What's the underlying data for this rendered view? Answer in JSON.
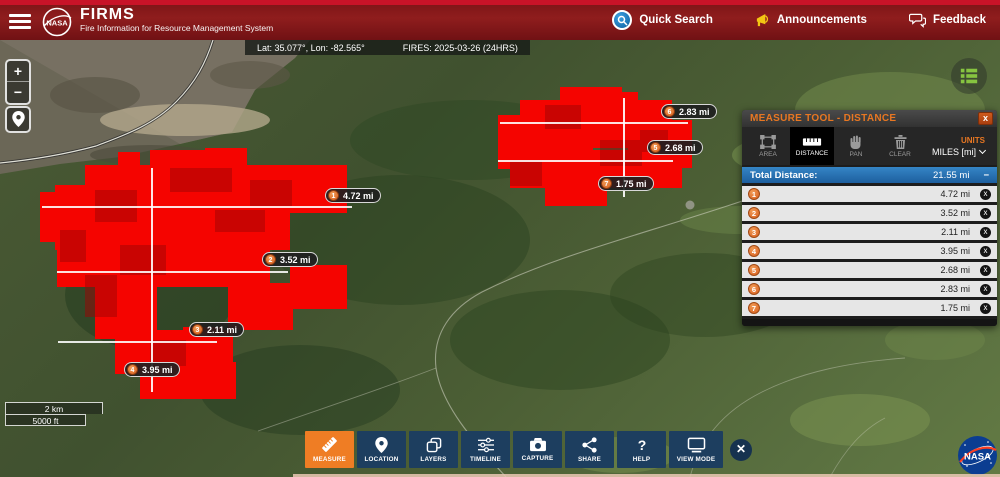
{
  "header": {
    "title": "FIRMS",
    "subtitle": "Fire Information for Resource Management System",
    "nav": {
      "quick_search": "Quick Search",
      "announcements": "Announcements",
      "feedback": "Feedback"
    }
  },
  "map": {
    "info_bar": {
      "coords": "Lat: 35.077°, Lon: -82.565°",
      "fires": "FIRES: 2025-03-26 (24HRS)"
    },
    "controls": {
      "zoom_in": "+",
      "zoom_out": "−"
    },
    "scale": {
      "km": "2 km",
      "ft": "5000 ft"
    },
    "labels": [
      {
        "num": "1",
        "text": "4.72 mi"
      },
      {
        "num": "2",
        "text": "3.52 mi"
      },
      {
        "num": "3",
        "text": "2.11 mi"
      },
      {
        "num": "4",
        "text": "3.95 mi"
      },
      {
        "num": "5",
        "text": "2.68 mi"
      },
      {
        "num": "6",
        "text": "2.83 mi"
      },
      {
        "num": "7",
        "text": "1.75 mi"
      }
    ]
  },
  "measure_panel": {
    "title": "MEASURE TOOL - DISTANCE",
    "close": "x",
    "tools": [
      {
        "label": "AREA"
      },
      {
        "label": "DISTANCE"
      },
      {
        "label": "PAN"
      },
      {
        "label": "CLEAR"
      }
    ],
    "units_label": "UNITS",
    "units_value": "MILES [mi]",
    "total_label": "Total Distance:",
    "total_value": "21.55 mi",
    "collapse": "−",
    "rows": [
      {
        "num": "1",
        "value": "4.72 mi",
        "delete": "x"
      },
      {
        "num": "2",
        "value": "3.52 mi",
        "delete": "x"
      },
      {
        "num": "3",
        "value": "2.11 mi",
        "delete": "x"
      },
      {
        "num": "4",
        "value": "3.95 mi",
        "delete": "x"
      },
      {
        "num": "5",
        "value": "2.68 mi",
        "delete": "x"
      },
      {
        "num": "6",
        "value": "2.83 mi",
        "delete": "x"
      },
      {
        "num": "7",
        "value": "1.75 mi",
        "delete": "x"
      }
    ]
  },
  "toolbar": {
    "buttons": [
      {
        "label": "MEASURE"
      },
      {
        "label": "LOCATION"
      },
      {
        "label": "LAYERS"
      },
      {
        "label": "TIMELINE"
      },
      {
        "label": "CAPTURE"
      },
      {
        "label": "SHARE"
      },
      {
        "label": "HELP"
      },
      {
        "label": "VIEW MODE"
      }
    ],
    "close": "✕"
  },
  "colors": {
    "header_red": "#8f1d1d",
    "top_strip_red": "#c81328",
    "fire_red": "#f50400",
    "fire_dark": "#a80505",
    "accent_orange": "#e87722",
    "measure_button_orange": "#ef7d24",
    "toolbar_navy": "#1d3e5f",
    "total_row_blue": "#2574b5",
    "announce_yellow": "#f3c613",
    "legend_green": "#86c440"
  }
}
